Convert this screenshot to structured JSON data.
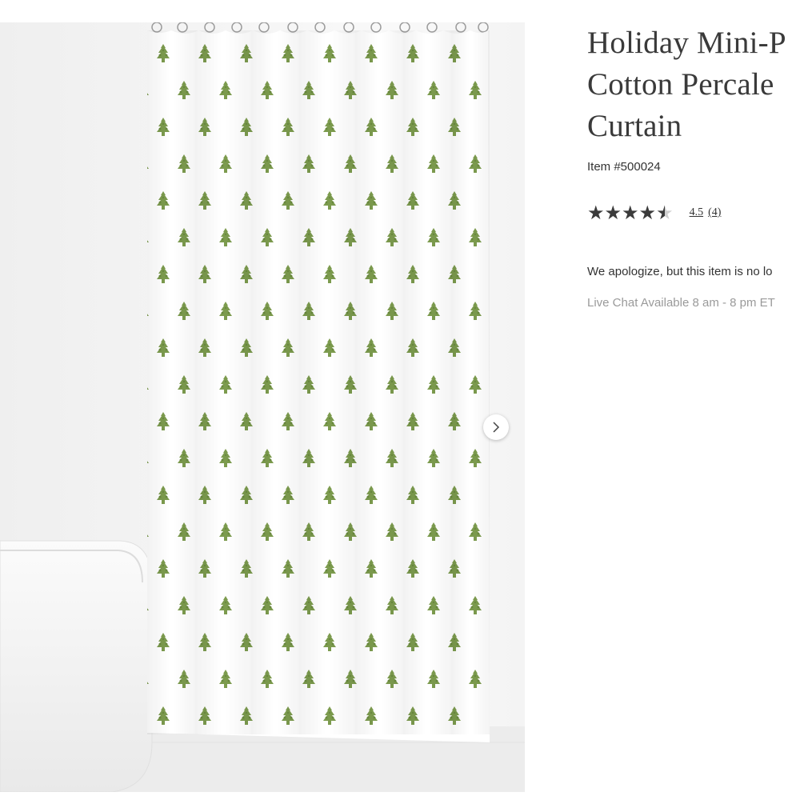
{
  "product": {
    "title_lines": [
      "Holiday Mini-P",
      "Cotton Percale",
      "Curtain"
    ],
    "item_number": "Item #500024",
    "rating": {
      "stars_value": 4.5,
      "value_text": "4.5",
      "count_text": "(4)"
    },
    "notice": "We apologize, but this item is no lo",
    "live_chat": "Live Chat Available 8 am - 8 pm ET"
  },
  "gallery": {
    "image_description_icon": "product-photo",
    "next_icon": "chevron-right-icon",
    "dots": [
      {
        "active": true
      },
      {
        "active": false
      },
      {
        "active": false
      },
      {
        "active": false
      }
    ]
  },
  "colors": {
    "print_green": "#7c9b4e",
    "title_text": "#3a3a3a",
    "muted_text": "#9a9a9a"
  }
}
